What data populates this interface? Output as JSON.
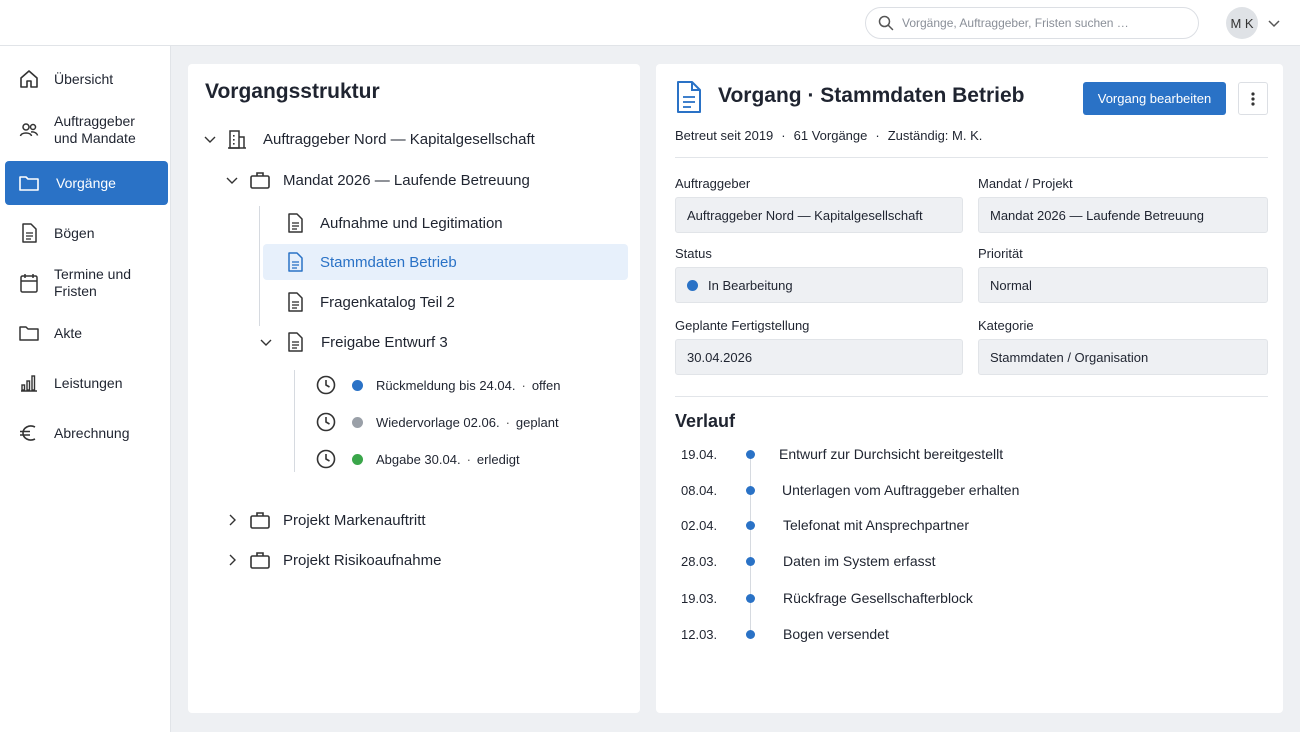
{
  "search": {
    "placeholder": "Vorgänge, Auftraggeber, Fristen suchen …"
  },
  "user": {
    "initials": "M K"
  },
  "sidebar": {
    "items": [
      {
        "label": "Übersicht",
        "icon": "home-icon"
      },
      {
        "label": "Auftraggeber und Mandate",
        "icon": "users-icon"
      },
      {
        "label": "Vorgänge",
        "icon": "folder-icon",
        "active": true
      },
      {
        "label": "Bögen",
        "icon": "document-icon"
      },
      {
        "label": "Termine und Fristen",
        "icon": "calendar-icon"
      },
      {
        "label": "Akte",
        "icon": "folder-icon"
      },
      {
        "label": "Leistungen",
        "icon": "bar-chart-icon"
      },
      {
        "label": "Abrechnung",
        "icon": "euro-icon"
      }
    ]
  },
  "tree": {
    "title": "Vorgangsstruktur",
    "client": "Auftraggeber Nord — Kapitalgesellschaft",
    "mandate": "Mandat 2026 — Laufende Betreuung",
    "docs": [
      "Aufnahme und Legitimation",
      "Stammdaten Betrieb",
      "Fragenkatalog Teil 2",
      "Freigabe Entwurf 3"
    ],
    "deadlines": [
      {
        "label": "Rückmeldung bis 24.04.",
        "sep": "·",
        "state": "offen",
        "color": "#2a72c6"
      },
      {
        "label": "Wiedervorlage 02.06.",
        "sep": "·",
        "state": "geplant",
        "color": "#9aa0a8"
      },
      {
        "label": "Abgabe 30.04.",
        "sep": "·",
        "state": "erledigt",
        "color": "#3aa64a"
      }
    ],
    "projects": [
      "Projekt Markenauftritt",
      "Projekt Risikoaufnahme"
    ]
  },
  "detail": {
    "title": "Vorgang · Stammdaten Betrieb",
    "edit_button": "Vorgang bearbeiten",
    "meta": [
      "Betreut seit 2019",
      "61 Vorgänge",
      "Zuständig: M. K."
    ],
    "meta_sep": "·",
    "fields": {
      "auftraggeber_label": "Auftraggeber",
      "auftraggeber": "Auftraggeber Nord — Kapitalgesellschaft",
      "mandat_label": "Mandat / Projekt",
      "mandat": "Mandat 2026 — Laufende Betreuung",
      "status_label": "Status",
      "status": "In Bearbeitung",
      "prioritaet_label": "Priorität",
      "prioritaet": "Normal",
      "fertig_label": "Geplante Fertigstellung",
      "fertig": "30.04.2026",
      "kategorie_label": "Kategorie",
      "kategorie": "Stammdaten / Organisation"
    },
    "verlauf_title": "Verlauf",
    "verlauf": [
      {
        "date": "19.04.",
        "text": "Entwurf zur Durchsicht bereitgestellt"
      },
      {
        "date": "08.04.",
        "text": "Unterlagen vom Auftraggeber erhalten"
      },
      {
        "date": "02.04.",
        "text": "Telefonat mit Ansprechpartner"
      },
      {
        "date": "28.03.",
        "text": "Daten im System erfasst"
      },
      {
        "date": "19.03.",
        "text": "Rückfrage Gesellschafterblock"
      },
      {
        "date": "12.03.",
        "text": "Bogen versendet"
      }
    ]
  },
  "colors": {
    "accent": "#2a72c6",
    "selected_bg": "#e7f0fb",
    "done": "#3aa64a",
    "planned": "#9aa0a8"
  }
}
